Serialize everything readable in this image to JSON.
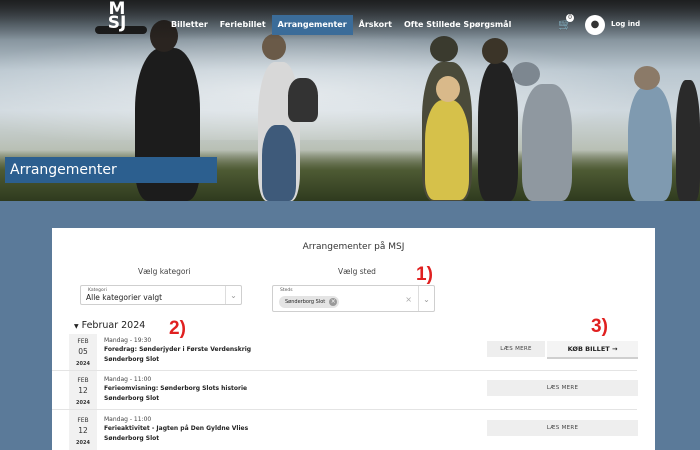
{
  "nav": {
    "logo_top": "M",
    "logo_bottom": "SJ",
    "links": [
      {
        "label": "Billetter"
      },
      {
        "label": "Feriebillet"
      },
      {
        "label": "Arrangementer"
      },
      {
        "label": "Årskort"
      },
      {
        "label": "Ofte Stillede Spørgsmål"
      }
    ],
    "cart_count": "0",
    "login_label": "Log ind"
  },
  "hero": {
    "title": "Arrangementer"
  },
  "panel": {
    "title": "Arrangementer på MSJ",
    "category": {
      "label": "Vælg kategori",
      "field_label": "Kategori",
      "value": "Alle kategorier valgt"
    },
    "place": {
      "label": "Vælg sted",
      "field_label": "Steds",
      "chip": "Sønderborg Slot"
    }
  },
  "annotations": {
    "a1": "1)",
    "a2": "2)",
    "a3": "3)"
  },
  "month": "Februar 2024",
  "events": [
    {
      "mon": "FEB",
      "day": "05",
      "year": "2024",
      "time": "Mandag - 19:30",
      "title": "Foredrag: Sønderjyder i Første Verdenskrig",
      "place": "Sønderborg Slot",
      "read_more": "LÆS MERE",
      "buy": "KØB BILLET"
    },
    {
      "mon": "FEB",
      "day": "12",
      "year": "2024",
      "time": "Mandag - 11:00",
      "title": "Ferieomvisning: Sønderborg Slots historie",
      "place": "Sønderborg Slot",
      "read_more": "LÆS MERE"
    },
    {
      "mon": "FEB",
      "day": "12",
      "year": "2024",
      "time": "Mandag - 11:00",
      "title": "Ferieaktivitet - Jagten på Den Gyldne Vlies",
      "place": "Sønderborg Slot",
      "read_more": "LÆS MERE"
    }
  ],
  "colors": {
    "accent": "#2c5f8f",
    "nav_active": "#3b6c99",
    "page_bg": "#5b7a99",
    "annotation": "#e02020"
  }
}
